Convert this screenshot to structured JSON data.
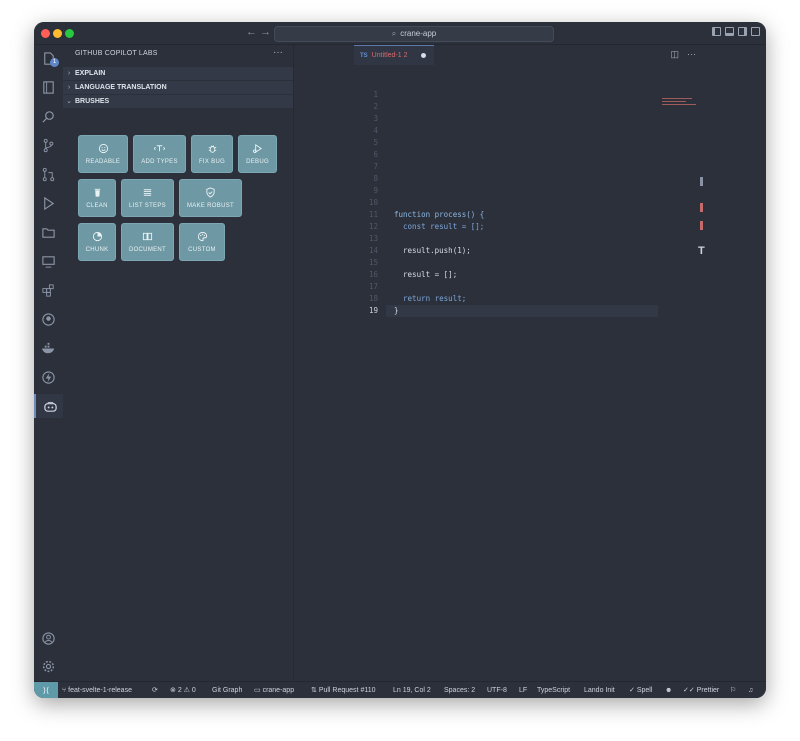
{
  "window": {
    "search_text": "crane-app"
  },
  "activity_bar": {
    "explorer_badge": "1"
  },
  "sidebar": {
    "title": "GITHUB COPILOT LABS",
    "more": "···",
    "sections": [
      {
        "label": "EXPLAIN",
        "expanded": false
      },
      {
        "label": "LANGUAGE TRANSLATION",
        "expanded": false
      },
      {
        "label": "BRUSHES",
        "expanded": true
      }
    ],
    "brushes": [
      {
        "label": "READABLE",
        "icon": "smile-icon"
      },
      {
        "label": "ADD TYPES",
        "icon": "type-icon"
      },
      {
        "label": "FIX BUG",
        "icon": "bug-icon"
      },
      {
        "label": "DEBUG",
        "icon": "debug-icon"
      },
      {
        "label": "CLEAN",
        "icon": "trash-icon"
      },
      {
        "label": "LIST STEPS",
        "icon": "list-icon"
      },
      {
        "label": "MAKE ROBUST",
        "icon": "shield-icon"
      },
      {
        "label": "CHUNK",
        "icon": "pie-icon"
      },
      {
        "label": "DOCUMENT",
        "icon": "book-icon"
      },
      {
        "label": "CUSTOM",
        "icon": "palette-icon"
      }
    ]
  },
  "editor": {
    "tab": {
      "lang": "TS",
      "title": "Untitled-1 2"
    },
    "current_line": "19",
    "lines": [
      {
        "n": "1",
        "text": ""
      },
      {
        "n": "2",
        "text": ""
      },
      {
        "n": "3",
        "text": ""
      },
      {
        "n": "4",
        "text": ""
      },
      {
        "n": "5",
        "text": ""
      },
      {
        "n": "6",
        "text": ""
      },
      {
        "n": "7",
        "text": ""
      },
      {
        "n": "8",
        "text": ""
      },
      {
        "n": "9",
        "text": ""
      },
      {
        "n": "10",
        "text": ""
      },
      {
        "n": "11",
        "text": "function process() {"
      },
      {
        "n": "12",
        "text": "  const result = [];"
      },
      {
        "n": "13",
        "text": ""
      },
      {
        "n": "14",
        "text": "  result.push(1);"
      },
      {
        "n": "15",
        "text": ""
      },
      {
        "n": "16",
        "text": "  result = [];"
      },
      {
        "n": "17",
        "text": ""
      },
      {
        "n": "18",
        "text": "  return result;"
      },
      {
        "n": "19",
        "text": "}"
      }
    ]
  },
  "status_bar": {
    "branch": "feat-svelte-1-release",
    "errors": "2",
    "warnings": "0",
    "git_graph": "Git Graph",
    "folder": "crane-app",
    "pull_request": "Pull Request #110",
    "position": "Ln 19, Col 2",
    "spaces": "Spaces: 2",
    "encoding": "UTF-8",
    "eol": "LF",
    "language": "TypeScript",
    "lando": "Lando Init",
    "spell": "Spell",
    "prettier": "Prettier"
  }
}
